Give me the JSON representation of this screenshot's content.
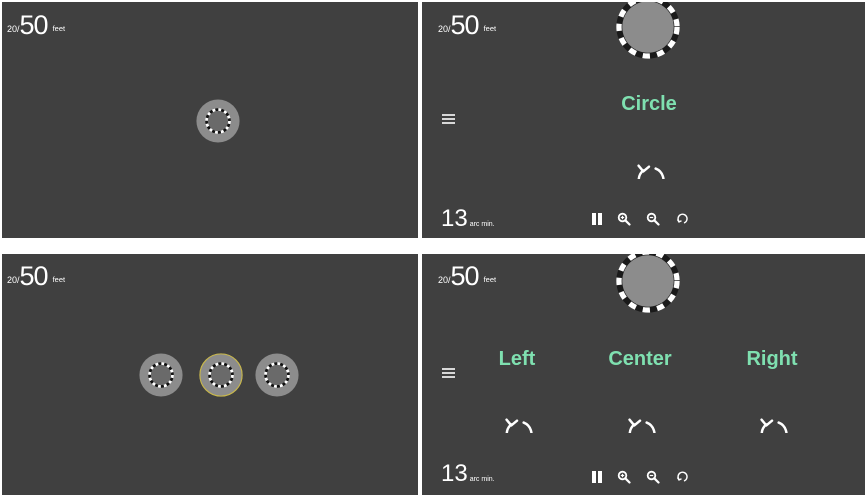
{
  "panels": [
    {
      "acuity": {
        "prefix": "20/",
        "value": "50",
        "unit": "feet"
      }
    },
    {
      "acuity": {
        "prefix": "20/",
        "value": "50",
        "unit": "feet"
      },
      "labels": [
        "Circle"
      ],
      "arc": {
        "value": "13",
        "unit": "arc min."
      }
    },
    {
      "acuity": {
        "prefix": "20/",
        "value": "50",
        "unit": "feet"
      }
    },
    {
      "acuity": {
        "prefix": "20/",
        "value": "50",
        "unit": "feet"
      },
      "labels": [
        "Left",
        "Center",
        "Right"
      ],
      "arc": {
        "value": "13",
        "unit": "arc min."
      }
    }
  ],
  "icons": {
    "menu": "hamburger-icon",
    "rotate": "rotate-arrow-icon",
    "pause": "pause-icon",
    "zoom_in": "zoom-in-icon",
    "zoom_out": "zoom-out-icon",
    "reset": "reset-rotate-icon"
  },
  "colors": {
    "background": "#404040",
    "label": "#7fe0b0",
    "highlight_ring": "#c9b84a",
    "stimulus": "#8c8c8c"
  }
}
